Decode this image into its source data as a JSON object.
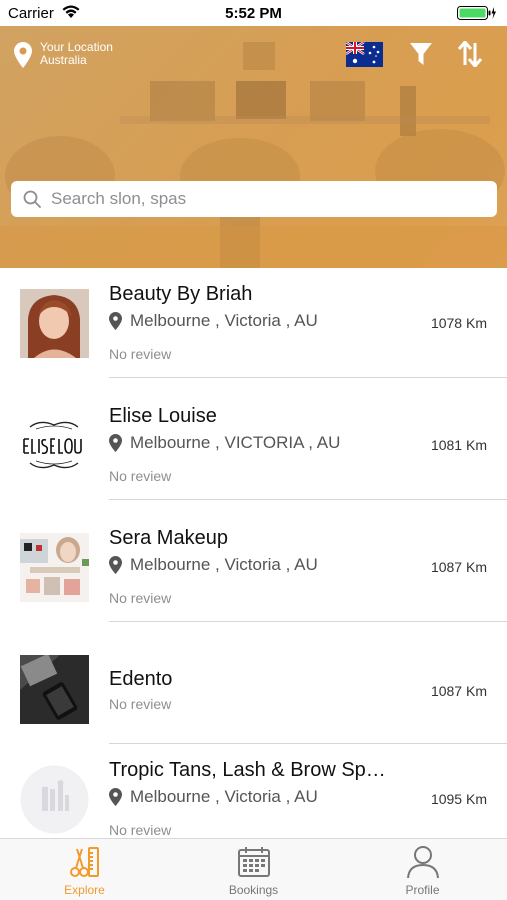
{
  "status_bar": {
    "carrier": "Carrier",
    "time": "5:52 PM"
  },
  "header": {
    "location_label": "Your Location",
    "location_value": "Australia",
    "flag_icon": "australia-flag-icon",
    "filter_icon": "filter-icon",
    "sort_icon": "sort-icon"
  },
  "search": {
    "placeholder": "Search slon, spas"
  },
  "salons": [
    {
      "name": "Beauty By Briah",
      "location": "Melbourne , Victoria , AU",
      "review": "No review",
      "distance": "1078 Km"
    },
    {
      "name": "Elise Louise",
      "location": "Melbourne , VICTORIA , AU",
      "review": "No review",
      "distance": "1081 Km"
    },
    {
      "name": "Sera Makeup",
      "location": "Melbourne , Victoria , AU",
      "review": "No review",
      "distance": "1087 Km"
    },
    {
      "name": "Edento",
      "location": "",
      "review": "No review",
      "distance": "1087 Km"
    },
    {
      "name": "Tropic Tans, Lash & Brow Sp…",
      "location": "Melbourne , Victoria , AU",
      "review": "No review",
      "distance": "1095 Km"
    }
  ],
  "tabs": [
    {
      "label": "Explore",
      "icon": "scissors-comb-icon",
      "active": true
    },
    {
      "label": "Bookings",
      "icon": "calendar-icon",
      "active": false
    },
    {
      "label": "Profile",
      "icon": "person-icon",
      "active": false
    }
  ],
  "colors": {
    "accent": "#f39a2d",
    "hero_orange": "#e39a3c"
  }
}
